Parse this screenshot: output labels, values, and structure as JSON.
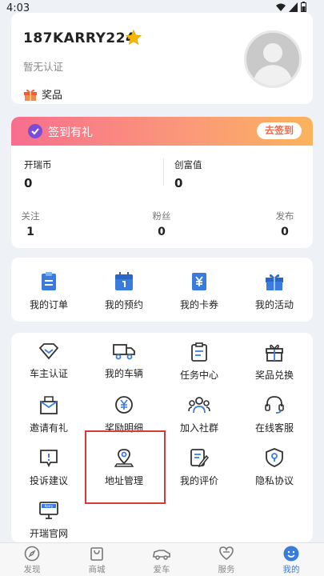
{
  "status_bar": {
    "time": "4:03"
  },
  "profile": {
    "username": "187KARRY224",
    "auth_status": "暂无认证",
    "prize_label": "奖品"
  },
  "signin": {
    "title": "签到有礼",
    "button": "去签到"
  },
  "stats": {
    "coins_label": "开瑞币",
    "coins_value": "0",
    "wealth_label": "创富值",
    "wealth_value": "0",
    "follow_label": "关注",
    "follow_value": "1",
    "fans_label": "粉丝",
    "fans_value": "0",
    "posts_label": "发布",
    "posts_value": "0"
  },
  "orders": [
    {
      "label": "我的订单",
      "icon": "order-icon"
    },
    {
      "label": "我的预约",
      "icon": "calendar-icon"
    },
    {
      "label": "我的卡券",
      "icon": "coupon-icon"
    },
    {
      "label": "我的活动",
      "icon": "gift-box-icon"
    }
  ],
  "services": [
    {
      "label": "车主认证",
      "icon": "badge-icon"
    },
    {
      "label": "我的车辆",
      "icon": "truck-icon"
    },
    {
      "label": "任务中心",
      "icon": "clipboard-icon"
    },
    {
      "label": "奖品兑换",
      "icon": "gift-icon"
    },
    {
      "label": "邀请有礼",
      "icon": "invite-icon"
    },
    {
      "label": "奖励明细",
      "icon": "yuan-icon"
    },
    {
      "label": "加入社群",
      "icon": "group-icon"
    },
    {
      "label": "在线客服",
      "icon": "headset-icon"
    },
    {
      "label": "投诉建议",
      "icon": "complaint-icon"
    },
    {
      "label": "地址管理",
      "icon": "location-icon"
    },
    {
      "label": "我的评价",
      "icon": "review-icon"
    },
    {
      "label": "隐私协议",
      "icon": "privacy-icon"
    },
    {
      "label": "开瑞官网",
      "icon": "monitor-icon"
    }
  ],
  "monitor_badge": "Karry",
  "tabs": [
    {
      "label": "发现",
      "icon": "compass-icon"
    },
    {
      "label": "商城",
      "icon": "bag-icon"
    },
    {
      "label": "爱车",
      "icon": "car-icon"
    },
    {
      "label": "服务",
      "icon": "service-heart-icon"
    },
    {
      "label": "我的",
      "icon": "user-icon",
      "active": true
    }
  ],
  "colors": {
    "accent": "#3a7bde",
    "highlight": "#d63a3a",
    "sign_gradient_start": "#f86e8e",
    "sign_gradient_end": "#fbb35c"
  }
}
